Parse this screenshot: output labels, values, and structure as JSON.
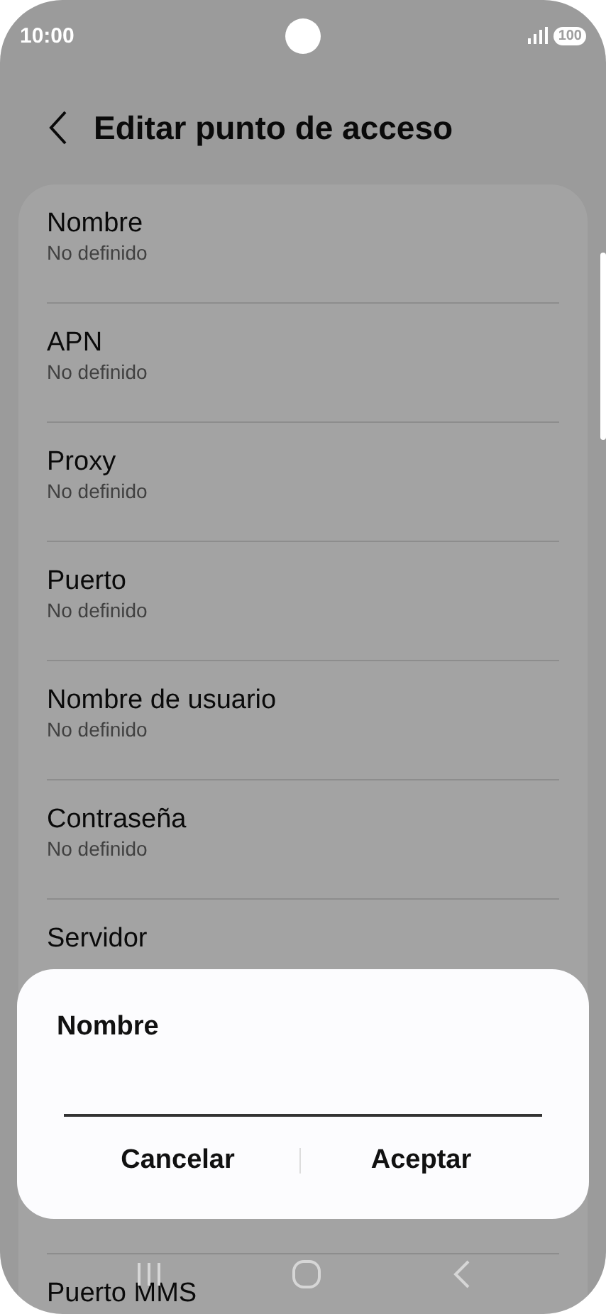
{
  "status_bar": {
    "time": "10:00",
    "battery": "100"
  },
  "header": {
    "title": "Editar punto de acceso"
  },
  "fields": [
    {
      "label": "Nombre",
      "value": "No definido"
    },
    {
      "label": "APN",
      "value": "No definido"
    },
    {
      "label": "Proxy",
      "value": "No definido"
    },
    {
      "label": "Puerto",
      "value": "No definido"
    },
    {
      "label": "Nombre de usuario",
      "value": "No definido"
    },
    {
      "label": "Contraseña",
      "value": "No definido"
    },
    {
      "label": "Servidor"
    },
    {
      "label": "Puerto MMS"
    }
  ],
  "dialog": {
    "title": "Nombre",
    "buttons": [
      "Cancelar",
      "Aceptar"
    ]
  }
}
